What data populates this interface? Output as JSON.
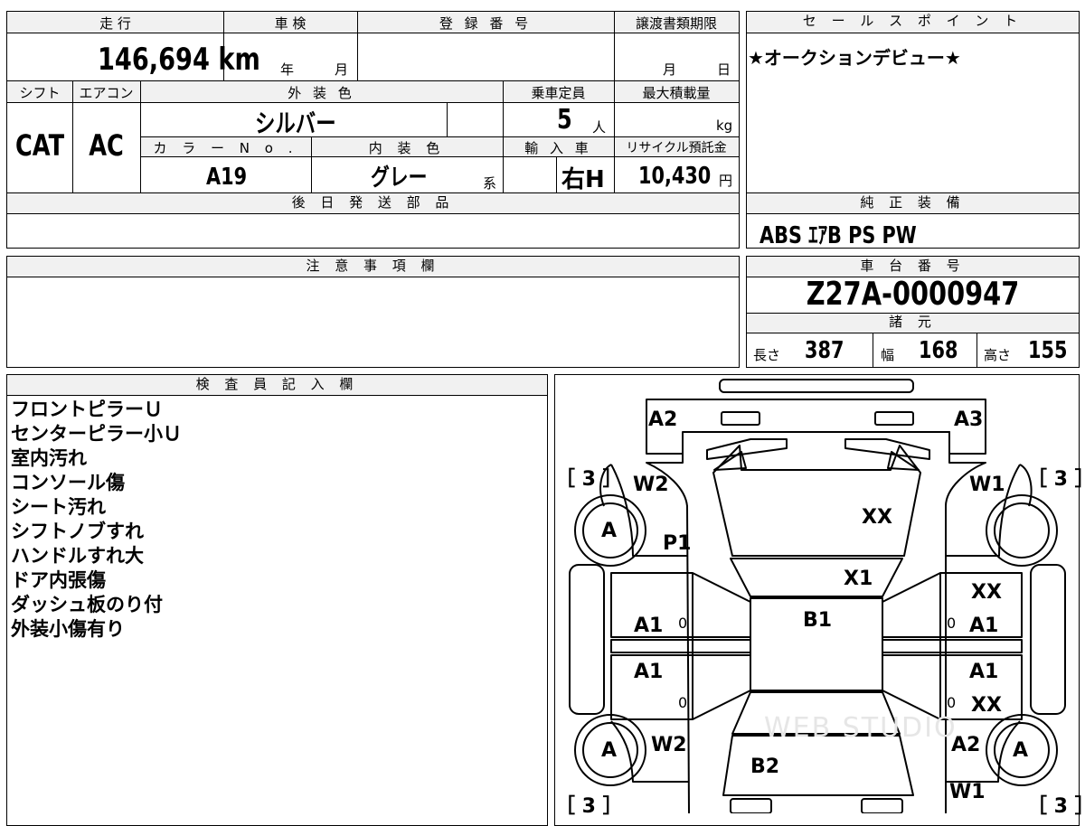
{
  "spec": {
    "mileage": {
      "header": "走 行",
      "value": "146,694 km"
    },
    "inspection": {
      "header": "車 検",
      "year_label": "年",
      "month_label": "月"
    },
    "registration": {
      "header": "登 録 番 号",
      "value": ""
    },
    "transfer_deadline": {
      "header": "譲渡書類期限",
      "month_label": "月",
      "day_label": "日"
    },
    "shift": {
      "header": "シフト",
      "value": "CAT"
    },
    "aircon": {
      "header": "エアコン",
      "value": "AC"
    },
    "exterior_color": {
      "header": "外 装 色",
      "value": "シルバー"
    },
    "capacity": {
      "header": "乗車定員",
      "value": "5",
      "unit": "人"
    },
    "max_load": {
      "header": "最大積載量",
      "value": "",
      "unit": "kg"
    },
    "color_no": {
      "header": "カ ラ ー N o .",
      "value": "A19"
    },
    "interior_color": {
      "header": "内 装 色",
      "value": "グレー",
      "suffix": "系"
    },
    "import": {
      "header": "輸 入 車",
      "value": "右H"
    },
    "recycle": {
      "header": "リサイクル預託金",
      "value": "10,430",
      "unit": "円"
    }
  },
  "later_parts": {
    "header": "後 日 発 送 部 品",
    "value": ""
  },
  "sales_point": {
    "header": "セ ー ル ス ポ イ ン ト",
    "text": "★オークションデビュー★"
  },
  "equipment": {
    "header": "純 正 装 備",
    "text": "ABS ｴｱB PS PW"
  },
  "notes": {
    "header": "注 意 事 項 欄",
    "text": ""
  },
  "chassis": {
    "header": "車 台 番 号",
    "value": "Z27A-0000947"
  },
  "dimensions": {
    "header": "諸 元",
    "length_label": "長さ",
    "length": "387",
    "width_label": "幅",
    "width": "168",
    "height_label": "高さ",
    "height": "155"
  },
  "inspector": {
    "header": "検 査 員 記 入 欄",
    "lines": [
      "フロントピラーＵ",
      "センターピラー小Ｕ",
      "室内汚れ",
      "コンソール傷",
      "シート汚れ",
      "シフトノブすれ",
      "ハンドルすれ大",
      "ドア内張傷",
      "ダッシュ板のり付",
      "外装小傷有り"
    ]
  },
  "diagram": {
    "marks": {
      "a2_top": "A2",
      "a3_top": "A3",
      "tire_fl": "［ 3 ］",
      "tire_fr": "［ 3 ］",
      "tire_rl": "［ 3 ］",
      "tire_rr": "［ 3 ］",
      "w2_front": "W2",
      "w1_front": "W1",
      "xx_hood": "XX",
      "p1": "P1",
      "x1": "X1",
      "wheel_fl": "A",
      "wheel_rl": "A",
      "wheel_rr": "A",
      "xx_door_fr": "XX",
      "a1_door_fl": "A1",
      "b1": "B1",
      "a1_door_fr": "A1",
      "a1_door_rl": "A1",
      "a1_door_rr": "A1",
      "xx_door_rr": "XX",
      "zero_fl": "0",
      "zero_fr": "0",
      "zero_rl": "0",
      "zero_rr": "0",
      "w2_rear": "W2",
      "a2_rear": "A2",
      "b2": "B2",
      "w1_rear": "W1"
    },
    "watermark": "WEB STUDIO"
  }
}
